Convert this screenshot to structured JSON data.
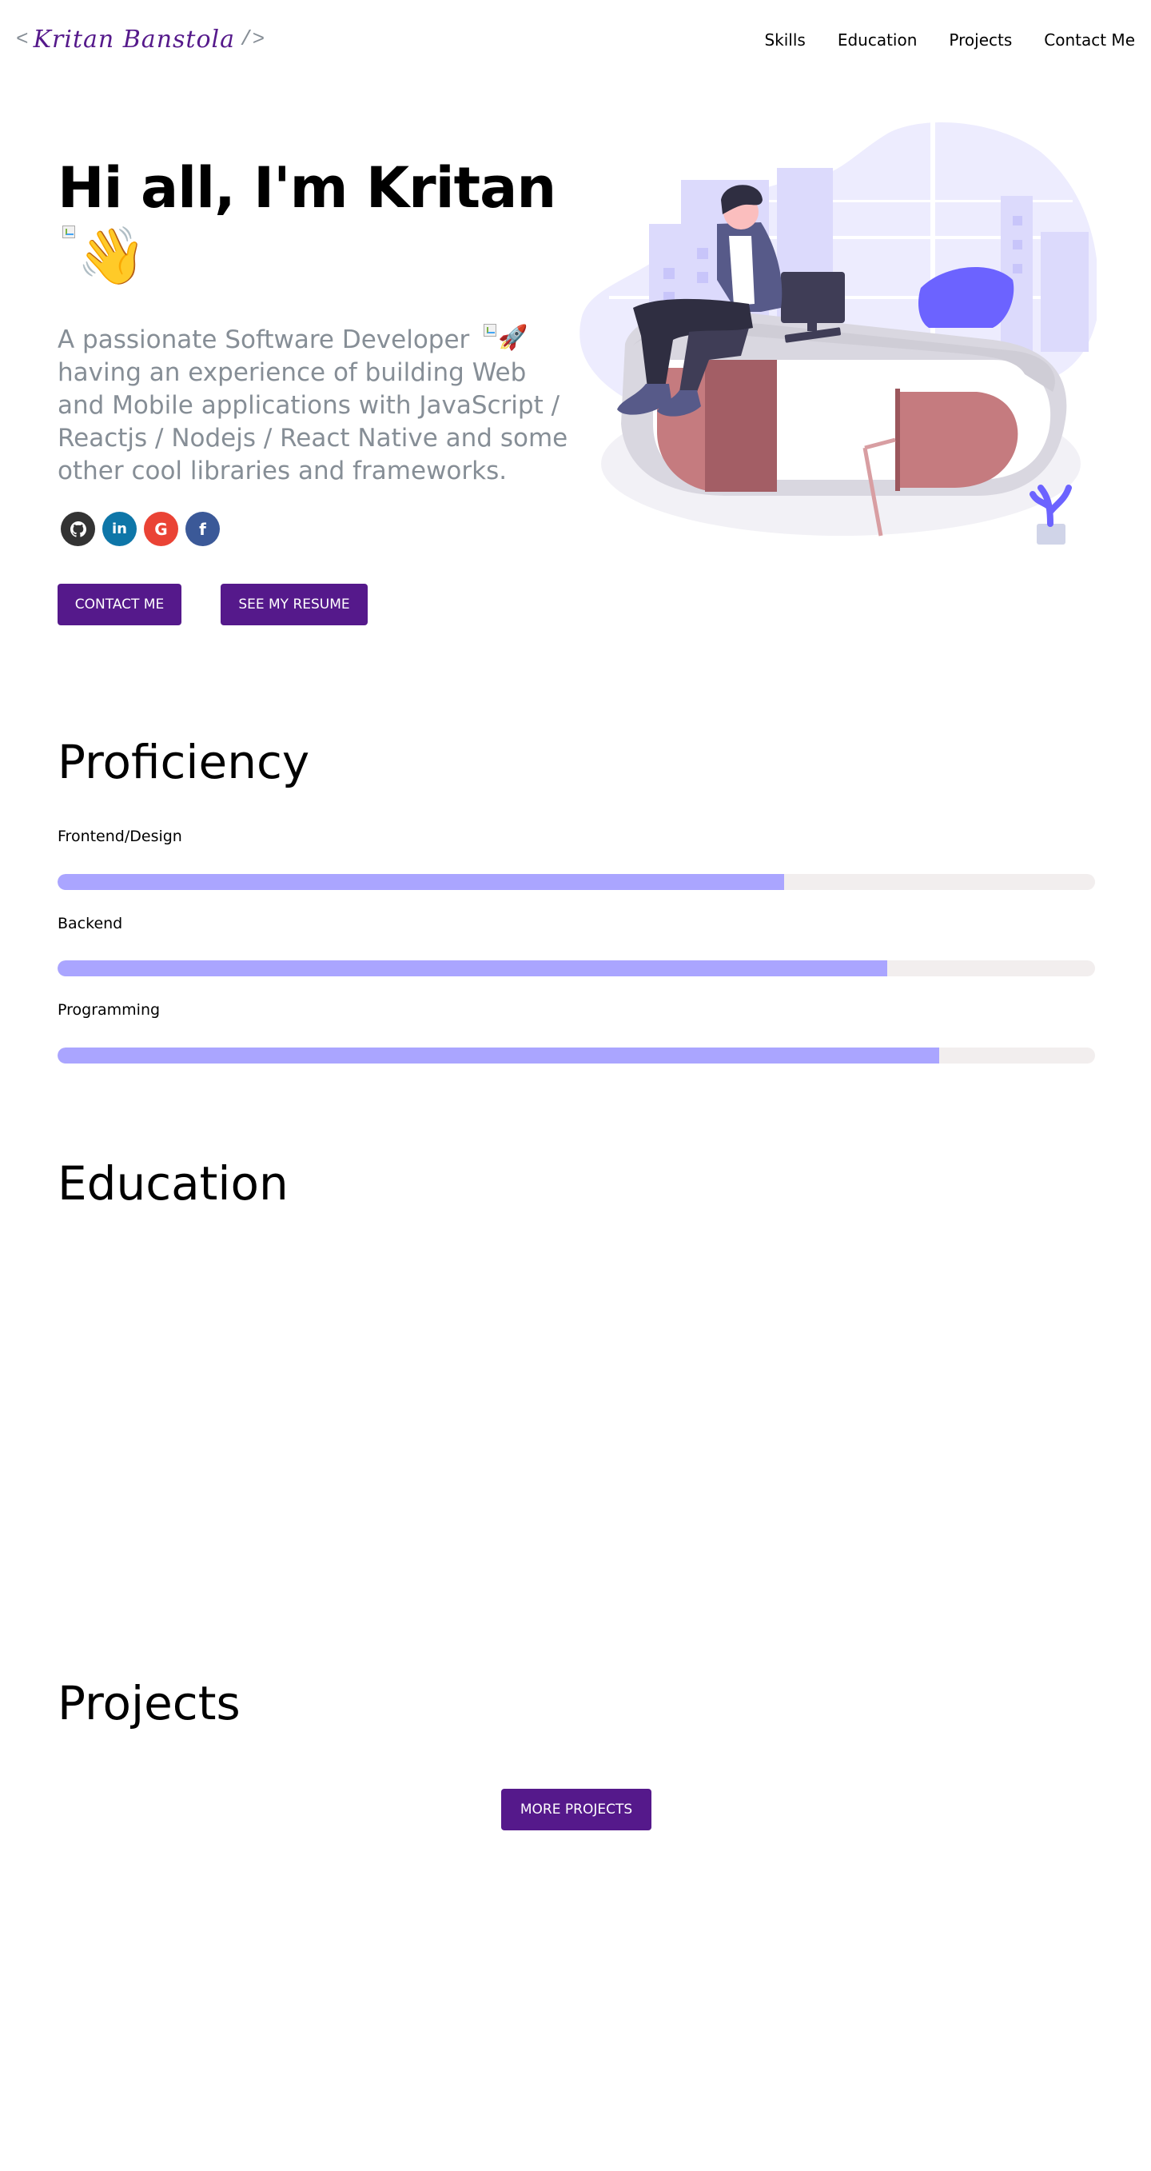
{
  "header": {
    "logo_open": "<",
    "logo_name": "Kritan Banstola",
    "logo_close": "/>",
    "nav": [
      "Skills",
      "Education",
      "Projects",
      "Contact Me"
    ]
  },
  "greeting": {
    "title": "Hi all, I'm Kritan",
    "wave_emoji": "👋",
    "subtitle": "A passionate Software Developer",
    "subtitle_rest": "having an experience of building Web and Mobile applications with JavaScript / Reactjs / Nodejs / React Native and some other cool libraries and frameworks.",
    "rocket_emoji": "🚀",
    "contact_button": "Contact me",
    "resume_button": "See my resume"
  },
  "socials": [
    {
      "name": "github-icon",
      "glyph": "◉",
      "color": "#333333"
    },
    {
      "name": "linkedin-icon",
      "glyph": "in",
      "color": "#0e76a8"
    },
    {
      "name": "google-icon",
      "glyph": "G",
      "color": "#ea4335"
    },
    {
      "name": "facebook-icon",
      "glyph": "f",
      "color": "#3b5998"
    }
  ],
  "proficiency": {
    "title": "Proficiency",
    "skills": [
      {
        "label": "Frontend/Design",
        "percent": 70
      },
      {
        "label": "Backend",
        "percent": 80
      },
      {
        "label": "Programming",
        "percent": 85
      }
    ]
  },
  "education": {
    "title": "Education"
  },
  "projects": {
    "title": "Projects",
    "more_button": "More Projects"
  },
  "colors": {
    "accent": "#55198b",
    "bar_fill": "#aaa5ff",
    "bar_track": "#f2eeee",
    "subtitle_text": "#868e96"
  }
}
